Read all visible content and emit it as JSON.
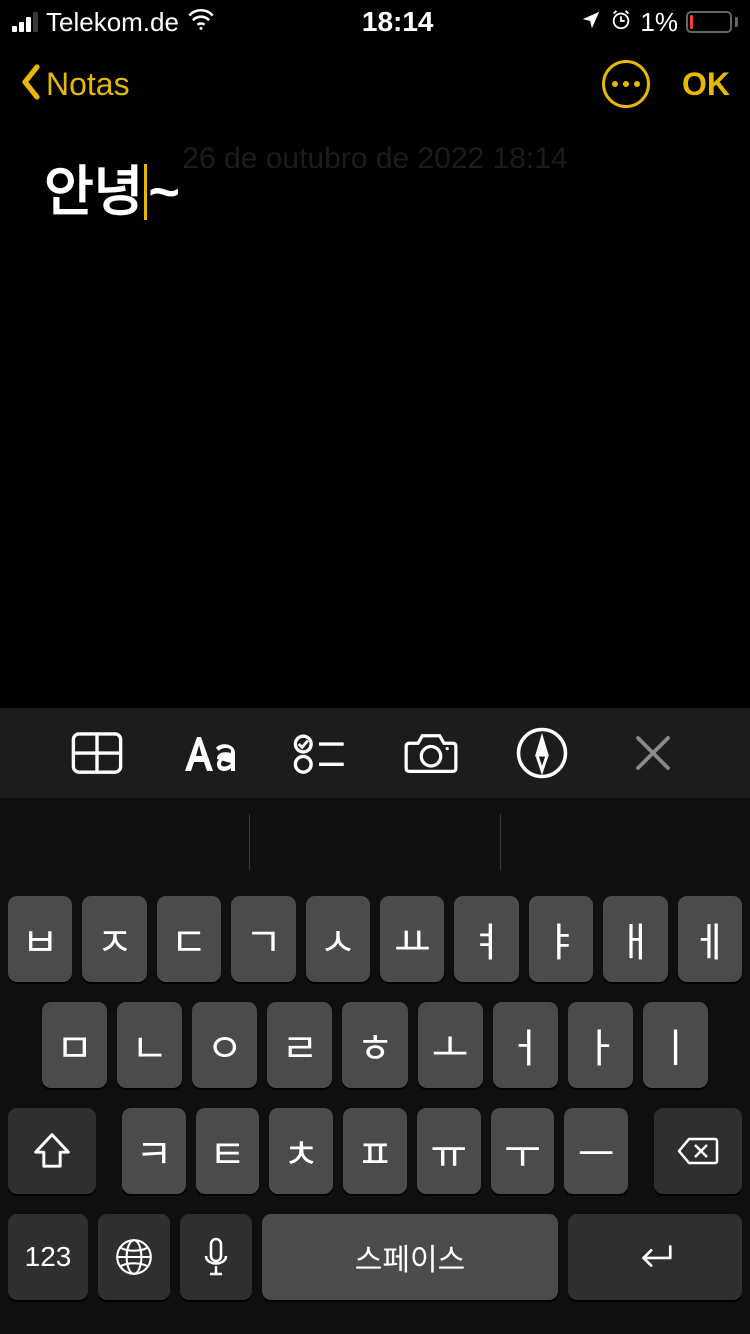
{
  "status_bar": {
    "carrier": "Telekom.de",
    "time": "18:14",
    "battery_percent": "1%",
    "location_active": true,
    "alarm_active": true
  },
  "nav": {
    "back_label": "Notas",
    "done_label": "OK"
  },
  "note": {
    "timestamp": "26 de outubro de 2022 18:14",
    "text_before_cursor": "안녕",
    "text_after_cursor": "~"
  },
  "toolbar": {
    "table_icon": "table-icon",
    "format_icon": "text-format-icon",
    "checklist_icon": "checklist-icon",
    "camera_icon": "camera-icon",
    "markup_icon": "markup-icon",
    "close_icon": "close-icon"
  },
  "keyboard": {
    "row1": [
      "ㅂ",
      "ㅈ",
      "ㄷ",
      "ㄱ",
      "ㅅ",
      "ㅛ",
      "ㅕ",
      "ㅑ",
      "ㅐ",
      "ㅔ"
    ],
    "row2": [
      "ㅁ",
      "ㄴ",
      "ㅇ",
      "ㄹ",
      "ㅎ",
      "ㅗ",
      "ㅓ",
      "ㅏ",
      "ㅣ"
    ],
    "row3": [
      "ㅋ",
      "ㅌ",
      "ㅊ",
      "ㅍ",
      "ㅠ",
      "ㅜ",
      "ㅡ"
    ],
    "numbers_label": "123",
    "space_label": "스페이스"
  },
  "colors": {
    "accent": "#e6b800"
  }
}
